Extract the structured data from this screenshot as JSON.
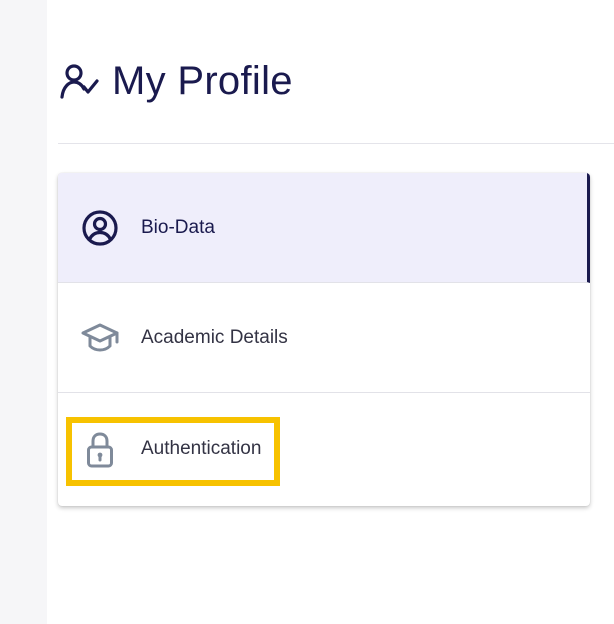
{
  "page": {
    "title": "My Profile",
    "icon": "user-check-icon"
  },
  "menu": {
    "items": [
      {
        "label": "Bio-Data",
        "icon": "user-circle-icon",
        "active": true
      },
      {
        "label": "Academic Details",
        "icon": "graduation-cap-icon",
        "active": false
      },
      {
        "label": "Authentication",
        "icon": "lock-icon",
        "active": false,
        "highlighted": true
      }
    ]
  },
  "colors": {
    "primary": "#1a1a4e",
    "active_bg": "#efeefb",
    "highlight": "#f7c200",
    "icon_gray": "#7f8a9a"
  }
}
